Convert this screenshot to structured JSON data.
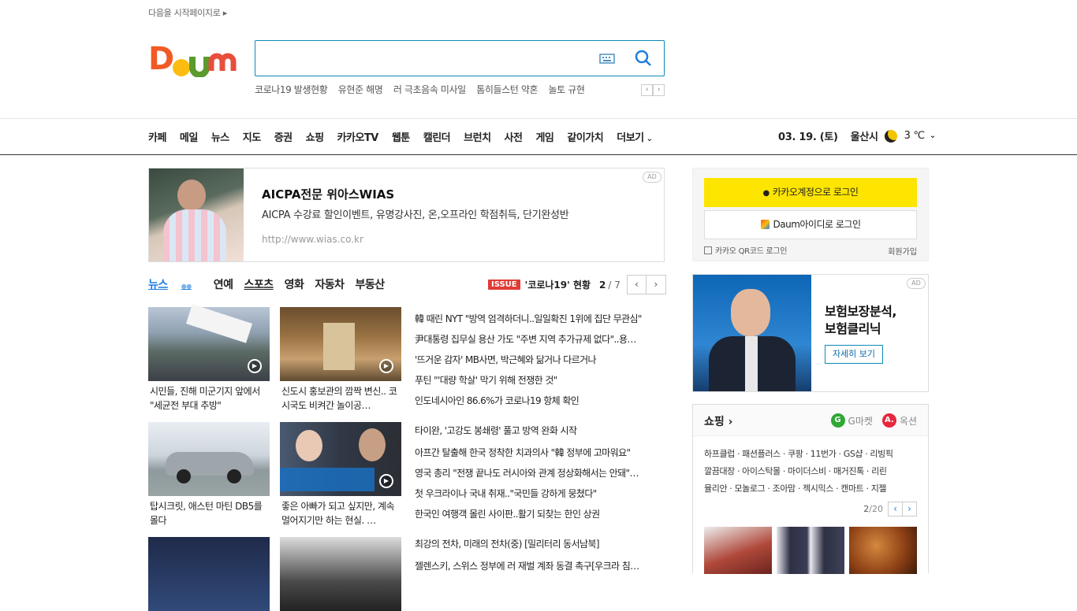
{
  "topline": "다음을 시작페이지로 ▸",
  "search": {
    "value": "",
    "placeholder": ""
  },
  "trending": {
    "items": [
      "코로나19 발생현황",
      "유현준 해명",
      "러 극초음속 미사일",
      "톰히들스턴 약혼",
      "놀토 규현"
    ],
    "prev": "‹",
    "next": "›"
  },
  "nav": {
    "items": [
      "카페",
      "메일",
      "뉴스",
      "지도",
      "증권",
      "쇼핑",
      "카카오TV",
      "웹툰",
      "캘린더",
      "브런치",
      "사전",
      "게임",
      "같이가치",
      "더보기"
    ],
    "date": "03. 19. (토)",
    "city": "울산시",
    "temp": "3 ℃"
  },
  "ad_top": {
    "badge": "AD",
    "title": "AICPA전문 위아스WIAS",
    "desc": "AICPA 수강료 할인이벤트, 유명강사진, 온,오프라인 학점취득, 단기완성반",
    "url": "http://www.wias.co.kr"
  },
  "news": {
    "tabs": [
      "뉴스",
      "연예",
      "스포츠",
      "영화",
      "자동차",
      "부동산"
    ],
    "issue_badge": "ISSUE",
    "issue_text": "'코로나19' 현황",
    "page": "2",
    "page_total": "/ 7",
    "thumbs": [
      {
        "caption": "시민들, 진해 미군기지 앞에서 \"세균전 부대 추방\""
      },
      {
        "caption": "신도시 홍보관의 깜짝 변신.. 코시국도 비켜간 놀이공…"
      },
      {
        "caption": "탑시크릿, 애스턴 마틴 DB5를 몰다"
      },
      {
        "caption": "좋은 아빠가 되고 싶지만, 계속 멀어지기만 하는 현실. …"
      }
    ],
    "headlines_1": [
      "韓 때린 NYT \"방역 엄격하더니..일일확진 1위에 집단 무관심\"",
      "尹대통령 집무실 용산 가도 \"주변 지역 추가규제 없다\"..용…",
      "'뜨거운 감자' MB사면, 박근혜와 닮거나 다르거나",
      "푸틴 \"'대량 학살' 막기 위해 전쟁한 것\"",
      "인도네시아인 86.6%가 코로나19 항체 확인"
    ],
    "headlines_2": [
      "타이완, '고강도 봉쇄령' 풀고 방역 완화 시작",
      "아프간 탈출해 한국 정착한 치과의사 \"韓 정부에 고마워요\"",
      "영국 총리 \"전쟁 끝나도 러시아와 관계 정상화해서는 안돼\"…",
      "첫 우크라이나 국내 취재..\"국민들 강하게 뭉쳤다\"",
      "한국인 여행객 몰린 사이판..활기 되찾는 한인 상권"
    ],
    "headlines_3": [
      "최강의 전차, 미래의 전차(중) [밀리터리 동서남북]",
      "젤렌스키, 스위스 정부에 러 재벌 계좌 동결 촉구[우크라 침…"
    ]
  },
  "login": {
    "kakao": "카카오계정으로 로그인",
    "daum": "Daum아이디로 로그인",
    "qr": "카카오 QR코드 로그인",
    "signup": "회원가입"
  },
  "ad_side": {
    "badge": "AD",
    "title_1": "보험보장분석,",
    "title_2": "보험클리닉",
    "button": "자세히 보기"
  },
  "shopping": {
    "title": "쇼핑 ›",
    "gmarket": "G마켓",
    "auction": "옥션",
    "row1": "하프클럽 · 패션플러스 · 쿠팡 · 11번가 · GS샵 · 리빙픽",
    "row2": "깔끔대장 · 아이스탁몰 · 마이더스비 · 매거진톡 · 리린",
    "row3": "뮬리안 · 모놀로그 · 조아맘 · 젝시믹스 · 캔마트 · 지젤",
    "page": "2",
    "total": "/20"
  },
  "colors": {
    "accent": "#0d8ab7",
    "kakao": "#fee500",
    "issue": "#e03b35"
  }
}
